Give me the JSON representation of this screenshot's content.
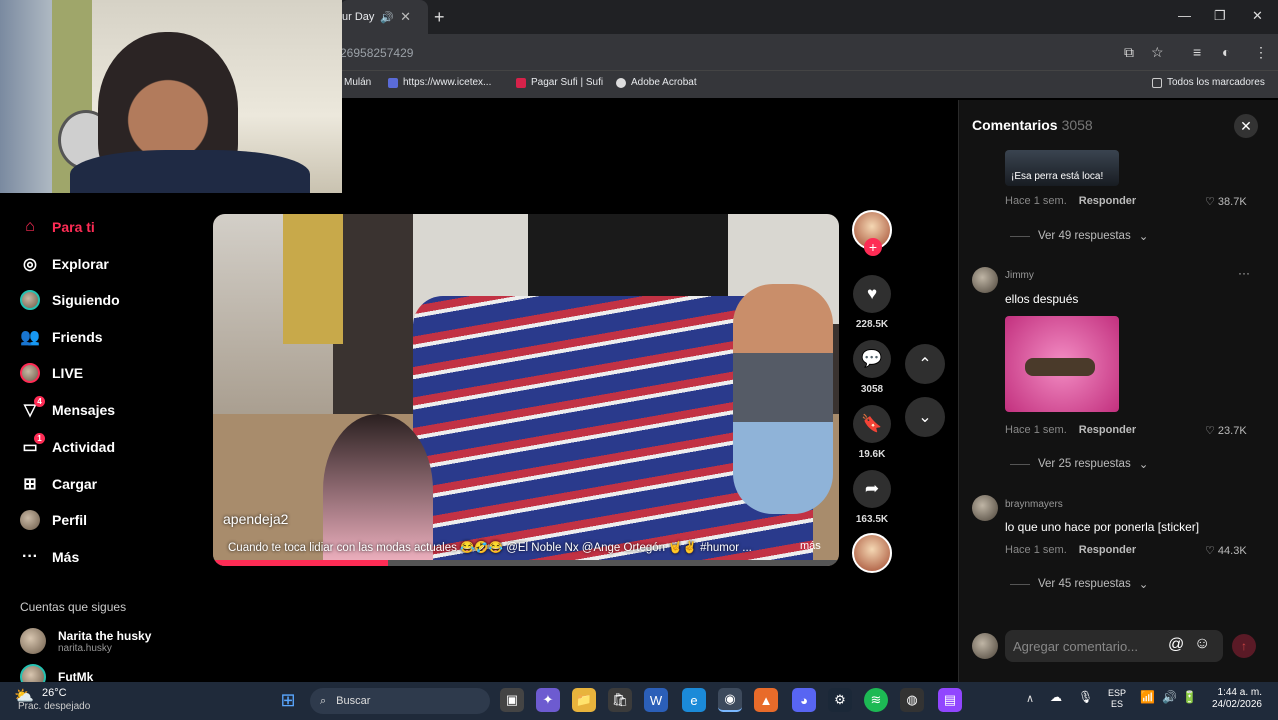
{
  "browser": {
    "tab_title": "ur Day",
    "url": "26958257429",
    "bookmarks": [
      "Mulán",
      "https://www.icetex...",
      "Pagar Sufi | Sufi",
      "Adobe Acrobat",
      "Todos los marcadores"
    ]
  },
  "sidebar": {
    "items": [
      {
        "label": "Para ti",
        "icon": "home-icon"
      },
      {
        "label": "Explorar",
        "icon": "compass-icon"
      },
      {
        "label": "Siguiendo",
        "icon": "following-icon"
      },
      {
        "label": "Friends",
        "icon": "friends-icon"
      },
      {
        "label": "LIVE",
        "icon": "live-icon"
      },
      {
        "label": "Mensajes",
        "icon": "messages-icon",
        "badge": "4"
      },
      {
        "label": "Actividad",
        "icon": "activity-icon",
        "badge": "1"
      },
      {
        "label": "Cargar",
        "icon": "upload-icon"
      },
      {
        "label": "Perfil",
        "icon": "profile-icon"
      },
      {
        "label": "Más",
        "icon": "more-icon"
      }
    ],
    "following_title": "Cuentas que sigues",
    "following": [
      {
        "name": "Narita the husky",
        "handle": "narita.husky"
      },
      {
        "name": "FutMk",
        "handle": ""
      }
    ]
  },
  "video": {
    "author": "apendeja2",
    "caption": "Cuando te toca lidiar con las modas actuales 😂🤣😂 @El Noble Nx @Ange Ortegón 🤘✌️ #humor ...",
    "more": "más"
  },
  "actions": {
    "likes": "228.5K",
    "comments": "3058",
    "saves": "19.6K",
    "shares": "163.5K"
  },
  "comments": {
    "title": "Comentarios",
    "count": "3058",
    "list": [
      {
        "user": "",
        "text": "",
        "image_caption": "¡Esa perra está loca!",
        "time": "Hace 1 sem.",
        "reply": "Responder",
        "likes": "38.7K",
        "replies": "Ver 49 respuestas"
      },
      {
        "user": "Jimmy",
        "text": "ellos después",
        "time": "Hace 1 sem.",
        "reply": "Responder",
        "likes": "23.7K",
        "replies": "Ver 25 respuestas"
      },
      {
        "user": "braynmayers",
        "text": "lo que uno hace por ponerla [sticker]",
        "time": "Hace 1 sem.",
        "reply": "Responder",
        "likes": "44.3K",
        "replies": "Ver 45 respuestas"
      }
    ],
    "input_placeholder": "Agregar comentario..."
  },
  "taskbar": {
    "weather_temp": "26°C",
    "weather_desc": "Prac. despejado",
    "search": "Buscar",
    "lang1": "ESP",
    "lang2": "ES",
    "time": "1:44 a. m.",
    "date": "24/02/2026"
  }
}
